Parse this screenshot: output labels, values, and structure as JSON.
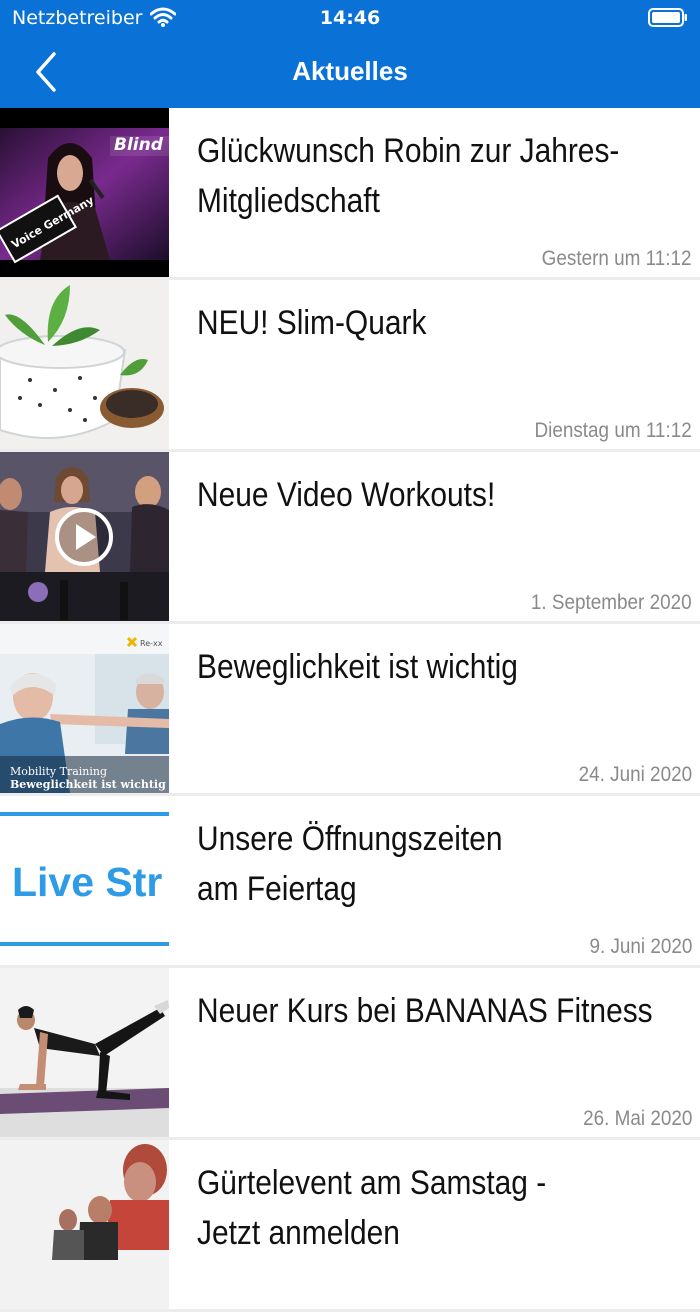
{
  "status": {
    "carrier": "Netzbetreiber",
    "time": "14:46",
    "wifi_icon": "wifi-icon",
    "battery_icon": "battery-icon"
  },
  "nav": {
    "title": "Aktuelles",
    "back_icon": "chevron-left-icon"
  },
  "colors": {
    "brand": "#0a72d6",
    "date_text": "#8a8a8a",
    "separator": "#ececec"
  },
  "news": [
    {
      "title_line1": "Glückwunsch Robin zur Jahres-",
      "title_line2": "Mitgliedschaft",
      "date": "Gestern um 11:12",
      "thumb_text": "Blind",
      "thumb_text2": "Voice Germany"
    },
    {
      "title_line1": "NEU! Slim-Quark",
      "title_line2": "",
      "date": "Dienstag um 11:12"
    },
    {
      "title_line1": "Neue Video Workouts!",
      "title_line2": "",
      "date": "1. September 2020",
      "play_icon": "play-icon"
    },
    {
      "title_line1": "Beweglichkeit ist wichtig",
      "title_line2": "",
      "date": "24. Juni 2020",
      "thumb_caption1": "Mobility Training",
      "thumb_caption2": "Beweglichkeit ist wichtig",
      "thumb_logo": "Re-xx"
    },
    {
      "title_line1": "Unsere Öffnungszeiten",
      "title_line2": "am Feiertag",
      "date": "9. Juni 2020",
      "thumb_text": "Live Str"
    },
    {
      "title_line1": "Neuer Kurs bei BANANAS Fitness",
      "title_line2": "",
      "date": "26. Mai 2020"
    },
    {
      "title_line1": "Gürtelevent am Samstag -",
      "title_line2": "Jetzt anmelden",
      "date": ""
    }
  ]
}
